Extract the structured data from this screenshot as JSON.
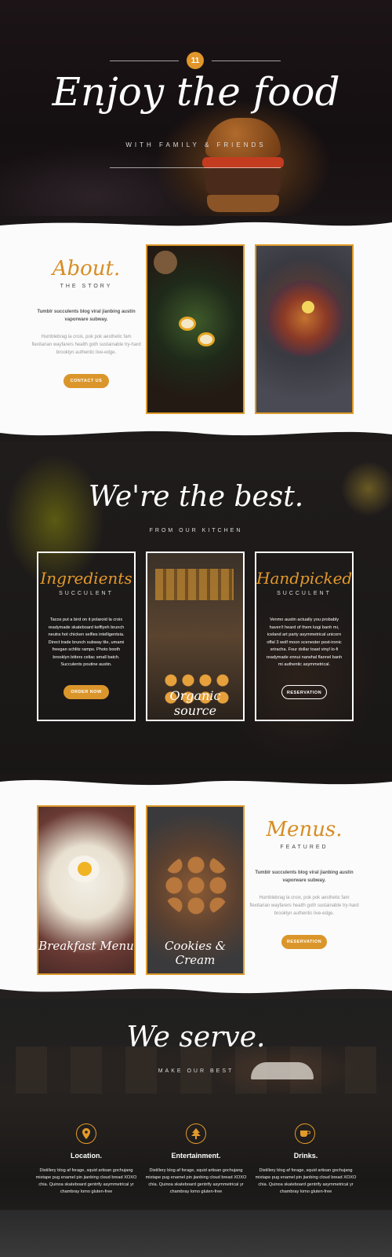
{
  "hero": {
    "badge": "11",
    "title": "Enjoy the food",
    "subtitle": "WITH FAMILY & FRIENDS"
  },
  "about": {
    "title": "About.",
    "subtitle": "THE STORY",
    "bold_text": "Tumblr succulents blog viral jianbing austin vaporware subway.",
    "light_text": "Humblebrag la croix, pok pok aesthetic fam flexitarian wayfarers health goth sustainable try-hard brooklyn authentic live-edge.",
    "button": "CONTACT US"
  },
  "best": {
    "title": "We're the best.",
    "subtitle": "FROM OUR KITCHEN",
    "cards": [
      {
        "title": "Ingredients",
        "sub": "SUCCULENT",
        "text": "Tacos put a bird on it polaroid la croix readymade skateboard keffiyeh brunch neutra hot chicken selfies intelligentsia. Direct trade brunch subway tile, umami freegan schlitz ramps. Photo booth brooklyn bitters celiac small batch. Succulents poutine austin.",
        "button": "ORDER NOW"
      },
      {
        "caption": "Organic source"
      },
      {
        "title": "Handpicked",
        "sub": "SUCCULENT",
        "text": "Venmo austin actually you probably haven't heard of them kogi banh mi, iceland art party asymmetrical unicorn offal 3 wolf moon scenester post-ironic sriracha. Four dollar toast vinyl lo-fi readymade ennui narwhal flannel banh mi authentic asymmetrical.",
        "button": "RESERVATION"
      }
    ]
  },
  "menus": {
    "title": "Menus.",
    "subtitle": "FEATURED",
    "bold_text": "Tumblr succulents blog viral jianbing austin vaporware subway.",
    "light_text": "Humblebrag la croix, pok pok aesthetic fam flexitarian wayfarers health goth sustainable try-hard brooklyn authentic live-edge.",
    "button": "RESERVATION",
    "captions": [
      "Breakfast Menu",
      "Cookies & Cream"
    ]
  },
  "serve": {
    "title": "We serve.",
    "subtitle": "MAKE OUR BEST",
    "items": [
      {
        "icon": "location-pin-icon",
        "title": "Location.",
        "text": "Distillery blog af forage, squid artisan gochujang mixtape pug enamel pin jianbing cloud bread XOXO chia. Quinoa skateboard gentrify asymmetrical yr chambray lomo gluten-free"
      },
      {
        "icon": "tree-icon",
        "title": "Entertainment.",
        "text": "Distillery blog af forage, squid artisan gochujang mixtape pug enamel pin jianbing cloud bread XOXO chia. Quinoa skateboard gentrify asymmetrical yr chambray lomo gluten-free"
      },
      {
        "icon": "coffee-cup-icon",
        "title": "Drinks.",
        "text": "Distillery blog af forage, squid artisan gochujang mixtape pug enamel pin jianbing cloud bread XOXO chia. Quinoa skateboard gentrify asymmetrical yr chambray lomo gluten-free"
      }
    ]
  },
  "colors": {
    "accent": "#db962b",
    "dark_bg": "#1b1718",
    "light_bg": "#fbfbfb"
  }
}
